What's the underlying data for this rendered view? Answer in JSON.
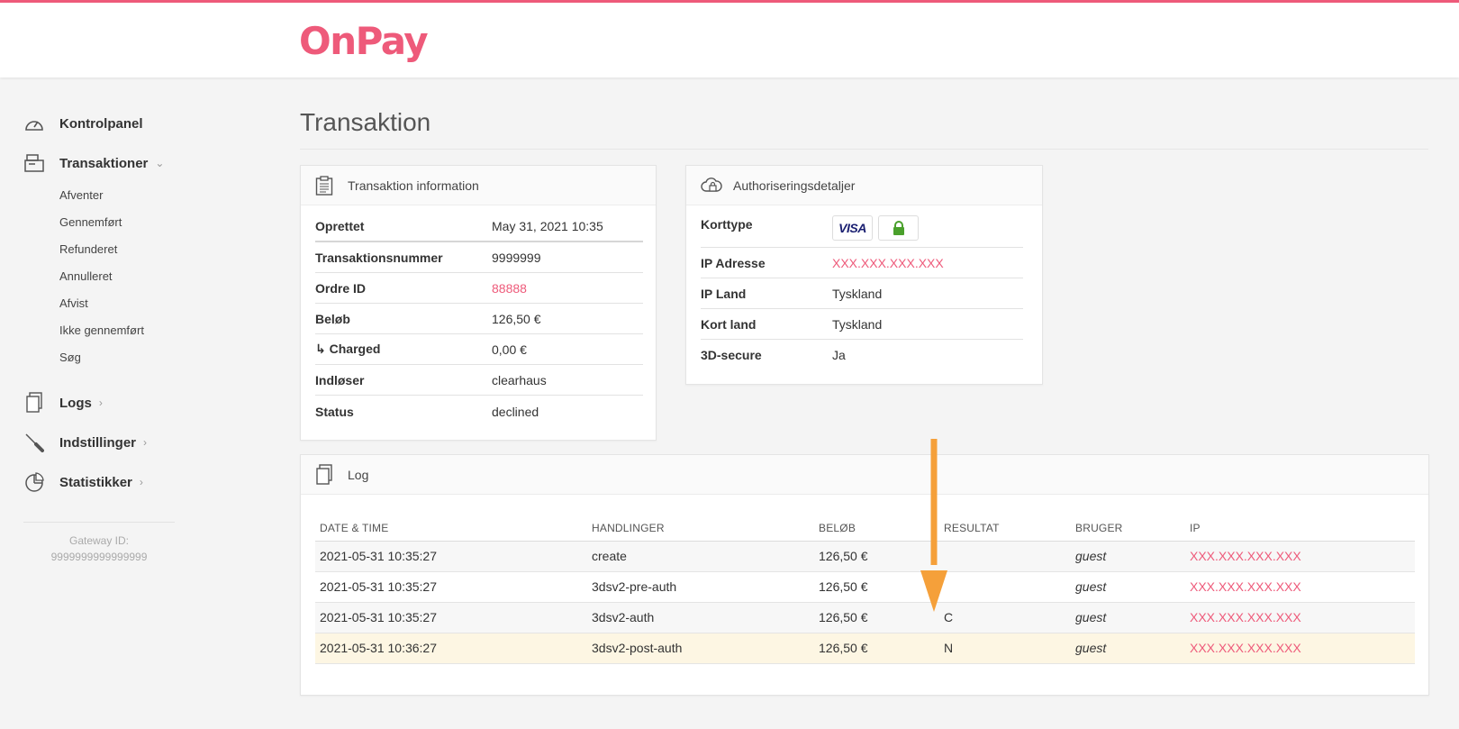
{
  "brand": {
    "logo_text": "OnPay",
    "accent_color": "#ee5a7a"
  },
  "sidebar": {
    "main_items": [
      {
        "label": "Kontrolpanel",
        "icon": "dashboard-gauge-icon"
      },
      {
        "label": "Transaktioner",
        "icon": "register-icon",
        "chevron": "chevron-down-icon",
        "expanded": true
      },
      {
        "label": "Logs",
        "icon": "documents-icon",
        "chevron": "chevron-right-icon"
      },
      {
        "label": "Indstillinger",
        "icon": "screwdriver-icon",
        "chevron": "chevron-right-icon"
      },
      {
        "label": "Statistikker",
        "icon": "pie-chart-icon",
        "chevron": "chevron-right-icon"
      }
    ],
    "transaction_subitems": [
      "Afventer",
      "Gennemført",
      "Refunderet",
      "Annulleret",
      "Afvist",
      "Ikke gennemført",
      "Søg"
    ],
    "gateway_label": "Gateway ID:",
    "gateway_id": "9999999999999999"
  },
  "page": {
    "title": "Transaktion"
  },
  "transaction_card": {
    "title": "Transaktion information",
    "rows": [
      {
        "key": "Oprettet",
        "value": "May 31, 2021 10:35"
      },
      {
        "key": "Transaktionsnummer",
        "value": "9999999"
      },
      {
        "key": "Ordre ID",
        "value": "88888"
      },
      {
        "key": "Beløb",
        "value": "126,50 €"
      },
      {
        "key": "↳ Charged",
        "value": "0,00 €"
      },
      {
        "key": "Indløser",
        "value": "clearhaus"
      },
      {
        "key": "Status",
        "value": "declined"
      }
    ]
  },
  "auth_card": {
    "title": "Authoriseringsdetaljer",
    "card_type_label": "Korttype",
    "card_brand": "VISA",
    "rows": [
      {
        "key": "IP Adresse",
        "value": "XXX.XXX.XXX.XXX"
      },
      {
        "key": "IP Land",
        "value": "Tyskland"
      },
      {
        "key": "Kort land",
        "value": "Tyskland"
      },
      {
        "key": "3D-secure",
        "value": "Ja"
      }
    ]
  },
  "log_card": {
    "title": "Log",
    "columns": [
      "DATE & TIME",
      "HANDLINGER",
      "BELØB",
      "RESULTAT",
      "BRUGER",
      "IP"
    ],
    "rows": [
      {
        "datetime": "2021-05-31 10:35:27",
        "action": "create",
        "amount": "126,50 €",
        "result": "",
        "user": "guest",
        "ip": "XXX.XXX.XXX.XXX"
      },
      {
        "datetime": "2021-05-31 10:35:27",
        "action": "3dsv2-pre-auth",
        "amount": "126,50 €",
        "result": "",
        "user": "guest",
        "ip": "XXX.XXX.XXX.XXX"
      },
      {
        "datetime": "2021-05-31 10:35:27",
        "action": "3dsv2-auth",
        "amount": "126,50 €",
        "result": "C",
        "user": "guest",
        "ip": "XXX.XXX.XXX.XXX"
      },
      {
        "datetime": "2021-05-31 10:36:27",
        "action": "3dsv2-post-auth",
        "amount": "126,50 €",
        "result": "N",
        "user": "guest",
        "ip": "XXX.XXX.XXX.XXX"
      }
    ]
  },
  "annotation": {
    "color": "#f5a03a"
  }
}
